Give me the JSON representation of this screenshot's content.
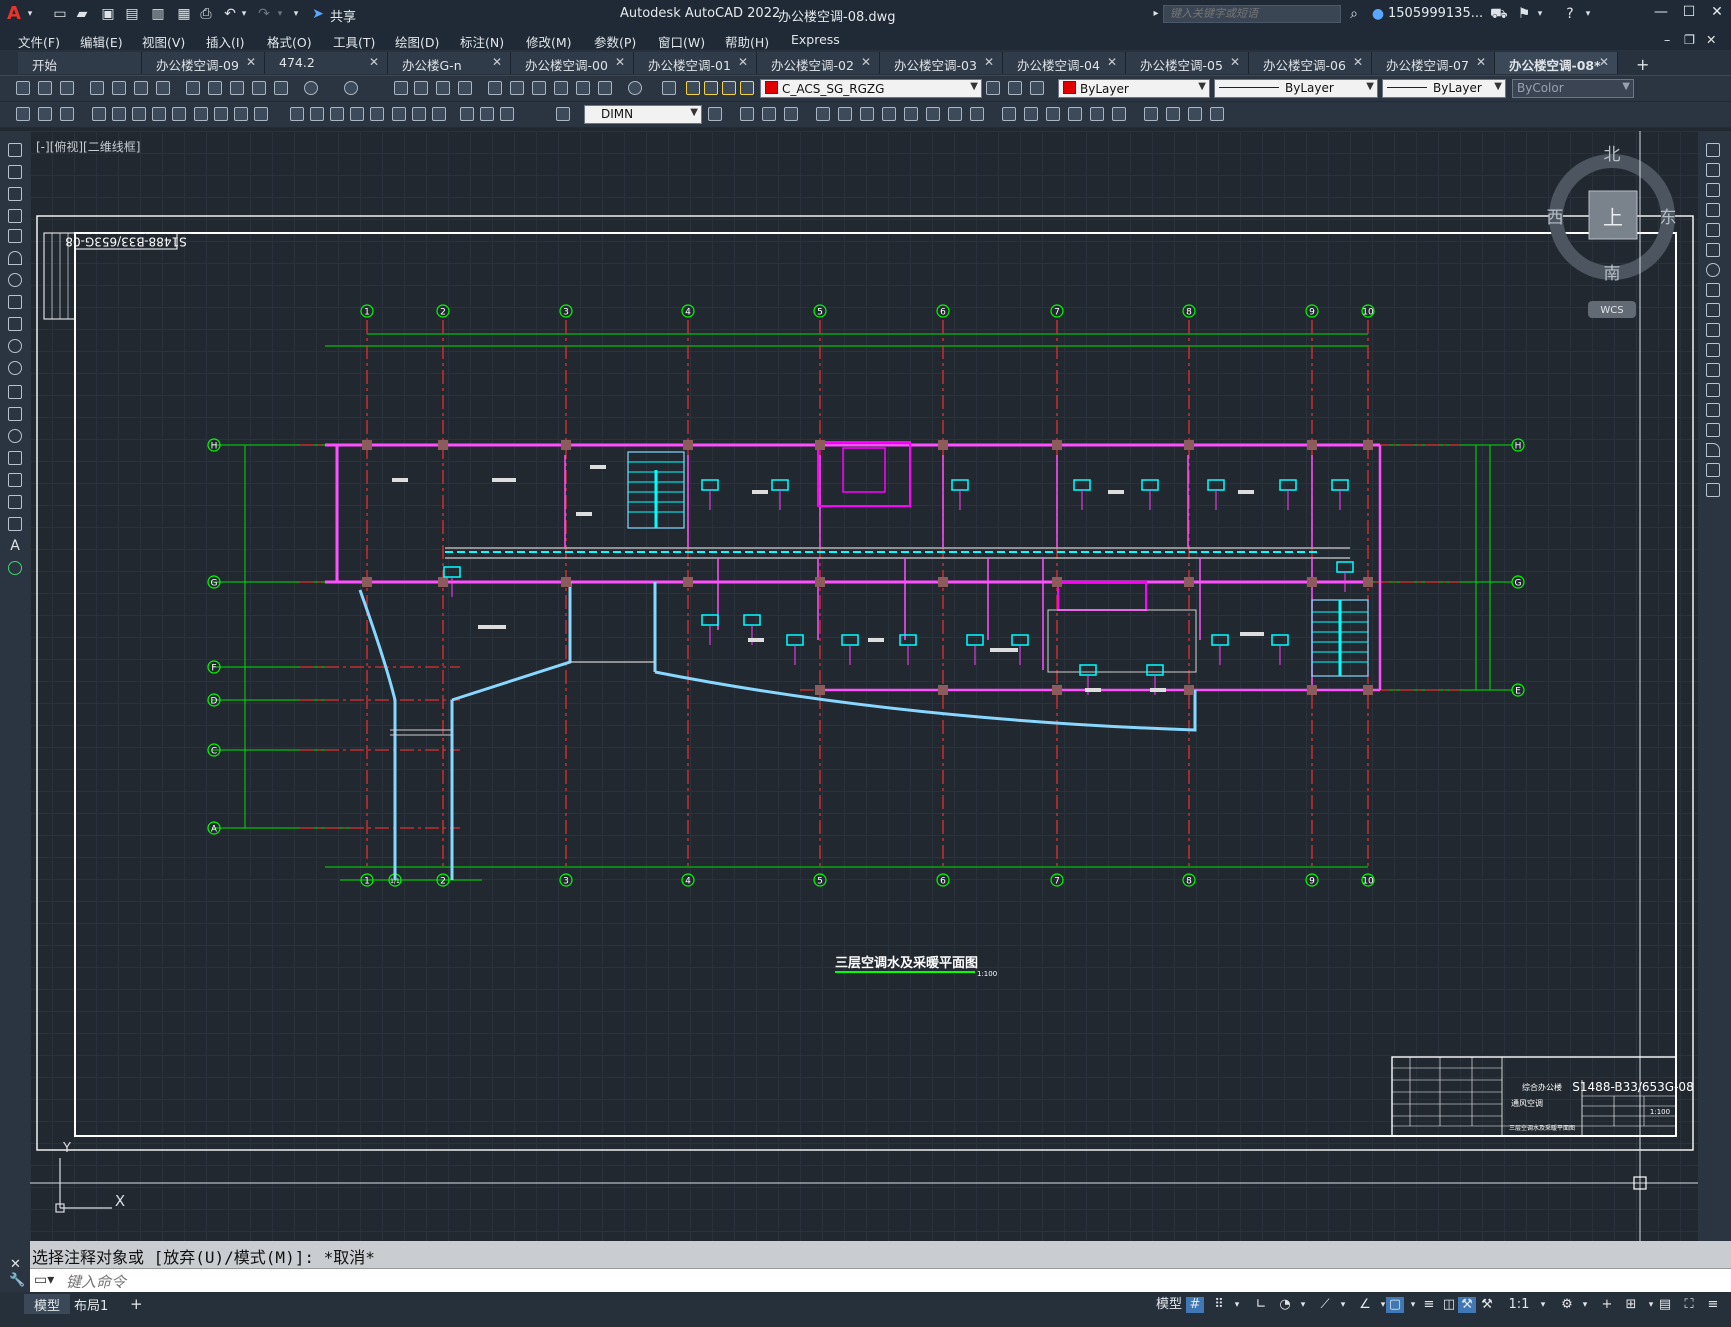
{
  "app": {
    "title": "Autodesk AutoCAD 2022",
    "filename": "办公楼空调-08.dwg",
    "share": "共享"
  },
  "search": {
    "placeholder": "键入关键字或短语"
  },
  "user": {
    "name": "1505999135..."
  },
  "menu": [
    "文件(F)",
    "编辑(E)",
    "视图(V)",
    "插入(I)",
    "格式(O)",
    "工具(T)",
    "绘图(D)",
    "标注(N)",
    "修改(M)",
    "参数(P)",
    "窗口(W)",
    "帮助(H)",
    "Express"
  ],
  "tabs": [
    "开始",
    "办公楼空调-09",
    "474.2",
    "办公楼G-n",
    "办公楼空调-00",
    "办公楼空调-01",
    "办公楼空调-02",
    "办公楼空调-03",
    "办公楼空调-04",
    "办公楼空调-05",
    "办公楼空调-06",
    "办公楼空调-07",
    "办公楼空调-08*"
  ],
  "layer": {
    "current": "C_ACS_SG_RGZG",
    "color": "ByLayer",
    "linetype": "ByLayer",
    "lineweight": "ByLayer",
    "plotstyle": "ByColor"
  },
  "dimstyle": "DIMN",
  "viewport": {
    "label": "[-][俯视][二维线框]"
  },
  "viewcube": {
    "north": "北",
    "south": "南",
    "east": "东",
    "west": "西",
    "top": "上",
    "wcs": "WCS"
  },
  "drawing": {
    "title": "三层空调水及采暖平面图",
    "scale": "1:100",
    "number": "S1488-B33/653G-08",
    "number_rotated": "S1488-B33/653G-08",
    "grid_cols": [
      "1",
      "2",
      "3",
      "4",
      "5",
      "6",
      "7",
      "8",
      "9",
      "10"
    ],
    "grid_rows": [
      "H",
      "G",
      "F",
      "D",
      "C",
      "A",
      "E"
    ],
    "grid_extra": [
      "1/1"
    ],
    "ucs": {
      "x": "X",
      "y": "Y"
    }
  },
  "titleblock": {
    "project": "综合办公楼",
    "system": "通风空调",
    "sheet": "三层空调水及采暖平面图",
    "scale": "1:100"
  },
  "command": {
    "history": "选择注释对象或 [放弃(U)/模式(M)]: *取消*",
    "placeholder": "键入命令"
  },
  "layouts": [
    "模型",
    "布局1"
  ],
  "status": {
    "model": "模型",
    "annoscale": "1:1"
  },
  "colors": {
    "cad_bg": "#212830",
    "grid_green": "#00ff00",
    "axis_red": "#ff2020",
    "wall_magenta": "#ff00ff",
    "duct_cyan": "#00ffff",
    "pipe_blue": "#7fd3ff"
  }
}
